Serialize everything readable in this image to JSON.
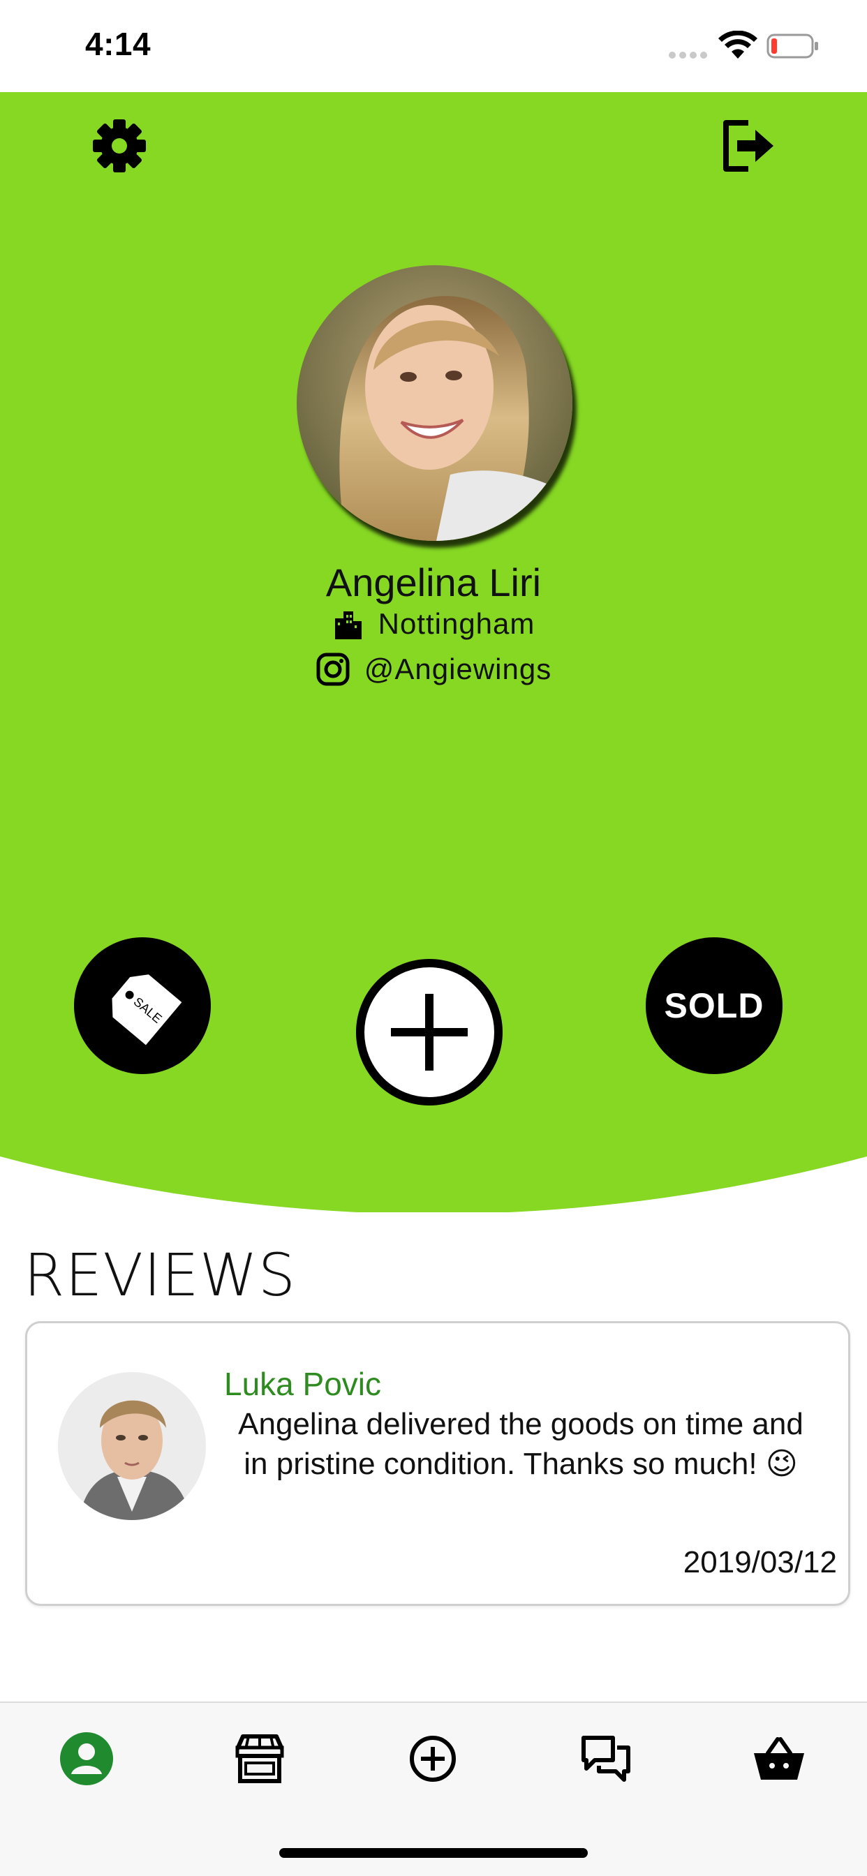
{
  "status": {
    "time": "4:14"
  },
  "colors": {
    "hero": "#86d823",
    "accent_green": "#2e8b1f",
    "black": "#000000"
  },
  "header": {
    "settings_icon": "gear-icon",
    "logout_icon": "logout-icon"
  },
  "profile": {
    "name": "Angelina Liri",
    "location": "Nottingham",
    "instagram": "@Angiewings"
  },
  "actions": {
    "sale_tag_text": "SALE",
    "sold_label": "SOLD",
    "add_icon": "plus-icon"
  },
  "reviews": {
    "title": "REVIEWS",
    "items": [
      {
        "reviewer": "Luka Povic",
        "text": "Angelina delivered the goods on time and in pristine condition. Thanks so much!  😉",
        "date": "2019/03/12"
      }
    ]
  },
  "tabbar": {
    "items": [
      "profile-icon",
      "store-icon",
      "add-circle-icon",
      "chat-icon",
      "basket-icon"
    ],
    "active": "profile-icon"
  }
}
